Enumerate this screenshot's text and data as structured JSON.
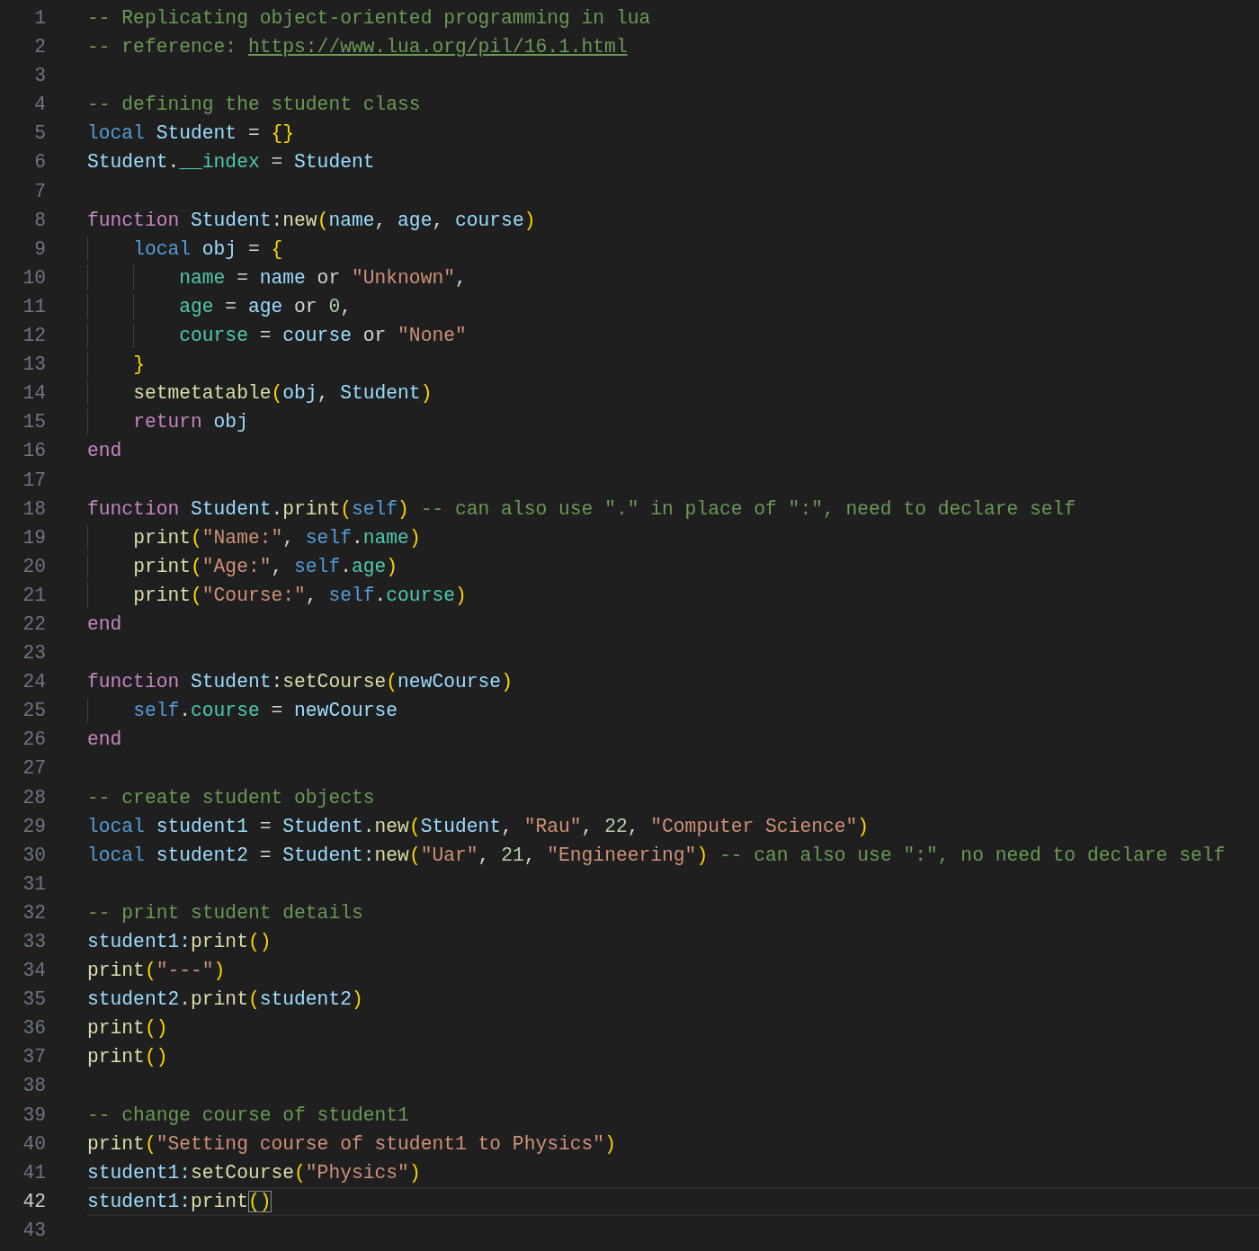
{
  "editor": {
    "lines": [
      {
        "number": "1",
        "selected": false,
        "tokens": [
          {
            "kind": "c",
            "t": "-- Replicating object-oriented programming in lua"
          }
        ]
      },
      {
        "number": "2",
        "selected": false,
        "tokens": [
          {
            "kind": "c",
            "t": "-- reference: "
          },
          {
            "kind": "link",
            "t": "https://www.lua.org/pil/16.1.html"
          }
        ]
      },
      {
        "number": "3",
        "selected": false
      },
      {
        "number": "4",
        "selected": false,
        "tokens": [
          {
            "kind": "c",
            "t": "-- defining the student class"
          }
        ]
      },
      {
        "number": "5",
        "selected": false,
        "tokens": [
          {
            "kind": "st",
            "t": "local "
          },
          {
            "kind": "v",
            "t": "Student"
          },
          {
            "kind": "p",
            "t": " = "
          },
          {
            "kind": "b",
            "t": "{}"
          }
        ]
      },
      {
        "number": "6",
        "selected": false,
        "tokens": [
          {
            "kind": "v",
            "t": "Student"
          },
          {
            "kind": "p",
            "t": "."
          },
          {
            "kind": "pr",
            "t": "__index"
          },
          {
            "kind": "p",
            "t": " = "
          },
          {
            "kind": "v",
            "t": "Student"
          }
        ]
      },
      {
        "number": "7",
        "selected": false
      },
      {
        "number": "8",
        "selected": false,
        "tokens": [
          {
            "kind": "kw",
            "t": "function "
          },
          {
            "kind": "v",
            "t": "Student"
          },
          {
            "kind": "p",
            "t": ":"
          },
          {
            "kind": "fn",
            "t": "new"
          },
          {
            "kind": "b",
            "t": "("
          },
          {
            "kind": "v",
            "t": "name"
          },
          {
            "kind": "p",
            "t": ", "
          },
          {
            "kind": "v",
            "t": "age"
          },
          {
            "kind": "p",
            "t": ", "
          },
          {
            "kind": "v",
            "t": "course"
          },
          {
            "kind": "b",
            "t": ")"
          }
        ]
      },
      {
        "number": "9",
        "selected": false,
        "tokens": [
          {
            "kind": "st",
            "t": "    local "
          },
          {
            "kind": "v",
            "t": "obj"
          },
          {
            "kind": "p",
            "t": " = "
          },
          {
            "kind": "b",
            "t": "{"
          }
        ]
      },
      {
        "number": "10",
        "selected": false,
        "tokens": [
          {
            "kind": "pr",
            "t": "        name"
          },
          {
            "kind": "p",
            "t": " = "
          },
          {
            "kind": "v",
            "t": "name"
          },
          {
            "kind": "p",
            "t": " or "
          },
          {
            "kind": "s",
            "t": "\"Unknown\""
          },
          {
            "kind": "p",
            "t": ","
          }
        ]
      },
      {
        "number": "11",
        "selected": false,
        "tokens": [
          {
            "kind": "pr",
            "t": "        age"
          },
          {
            "kind": "p",
            "t": " = "
          },
          {
            "kind": "v",
            "t": "age"
          },
          {
            "kind": "p",
            "t": " or "
          },
          {
            "kind": "n",
            "t": "0"
          },
          {
            "kind": "p",
            "t": ","
          }
        ]
      },
      {
        "number": "12",
        "selected": false,
        "tokens": [
          {
            "kind": "pr",
            "t": "        course"
          },
          {
            "kind": "p",
            "t": " = "
          },
          {
            "kind": "v",
            "t": "course"
          },
          {
            "kind": "p",
            "t": " or "
          },
          {
            "kind": "s",
            "t": "\"None\""
          }
        ]
      },
      {
        "number": "13",
        "selected": false,
        "tokens": [
          {
            "kind": "b",
            "t": "    }"
          }
        ]
      },
      {
        "number": "14",
        "selected": false,
        "tokens": [
          {
            "kind": "fn",
            "t": "    setmetatable"
          },
          {
            "kind": "b",
            "t": "("
          },
          {
            "kind": "v",
            "t": "obj"
          },
          {
            "kind": "p",
            "t": ", "
          },
          {
            "kind": "v",
            "t": "Student"
          },
          {
            "kind": "b",
            "t": ")"
          }
        ]
      },
      {
        "number": "15",
        "selected": false,
        "tokens": [
          {
            "kind": "kw",
            "t": "    return "
          },
          {
            "kind": "v",
            "t": "obj"
          }
        ]
      },
      {
        "number": "16",
        "selected": false,
        "tokens": [
          {
            "kind": "kw",
            "t": "end"
          }
        ]
      },
      {
        "number": "17",
        "selected": false
      },
      {
        "number": "18",
        "selected": false,
        "tokens": [
          {
            "kind": "kw",
            "t": "function "
          },
          {
            "kind": "v",
            "t": "Student"
          },
          {
            "kind": "p",
            "t": "."
          },
          {
            "kind": "fn",
            "t": "print"
          },
          {
            "kind": "b",
            "t": "("
          },
          {
            "kind": "st",
            "t": "self"
          },
          {
            "kind": "b",
            "t": ")"
          },
          {
            "kind": "c",
            "t": " -- can also use \".\" in place of \":\", need to declare self"
          }
        ]
      },
      {
        "number": "19",
        "selected": false,
        "tokens": [
          {
            "kind": "fn",
            "t": "    print"
          },
          {
            "kind": "b",
            "t": "("
          },
          {
            "kind": "s",
            "t": "\"Name:\""
          },
          {
            "kind": "p",
            "t": ", "
          },
          {
            "kind": "st",
            "t": "self"
          },
          {
            "kind": "p",
            "t": "."
          },
          {
            "kind": "pr",
            "t": "name"
          },
          {
            "kind": "b",
            "t": ")"
          }
        ]
      },
      {
        "number": "20",
        "selected": false,
        "tokens": [
          {
            "kind": "fn",
            "t": "    print"
          },
          {
            "kind": "b",
            "t": "("
          },
          {
            "kind": "s",
            "t": "\"Age:\""
          },
          {
            "kind": "p",
            "t": ", "
          },
          {
            "kind": "st",
            "t": "self"
          },
          {
            "kind": "p",
            "t": "."
          },
          {
            "kind": "pr",
            "t": "age"
          },
          {
            "kind": "b",
            "t": ")"
          }
        ]
      },
      {
        "number": "21",
        "selected": false,
        "tokens": [
          {
            "kind": "fn",
            "t": "    print"
          },
          {
            "kind": "b",
            "t": "("
          },
          {
            "kind": "s",
            "t": "\"Course:\""
          },
          {
            "kind": "p",
            "t": ", "
          },
          {
            "kind": "st",
            "t": "self"
          },
          {
            "kind": "p",
            "t": "."
          },
          {
            "kind": "pr",
            "t": "course"
          },
          {
            "kind": "b",
            "t": ")"
          }
        ]
      },
      {
        "number": "22",
        "selected": false,
        "tokens": [
          {
            "kind": "kw",
            "t": "end"
          }
        ]
      },
      {
        "number": "23",
        "selected": false
      },
      {
        "number": "24",
        "selected": false,
        "tokens": [
          {
            "kind": "kw",
            "t": "function "
          },
          {
            "kind": "v",
            "t": "Student"
          },
          {
            "kind": "p",
            "t": ":"
          },
          {
            "kind": "fn",
            "t": "setCourse"
          },
          {
            "kind": "b",
            "t": "("
          },
          {
            "kind": "v",
            "t": "newCourse"
          },
          {
            "kind": "b",
            "t": ")"
          }
        ]
      },
      {
        "number": "25",
        "selected": false,
        "tokens": [
          {
            "kind": "st",
            "t": "    self"
          },
          {
            "kind": "p",
            "t": "."
          },
          {
            "kind": "pr",
            "t": "course"
          },
          {
            "kind": "p",
            "t": " = "
          },
          {
            "kind": "v",
            "t": "newCourse"
          }
        ]
      },
      {
        "number": "26",
        "selected": false,
        "tokens": [
          {
            "kind": "kw",
            "t": "end"
          }
        ]
      },
      {
        "number": "27",
        "selected": false
      },
      {
        "number": "28",
        "selected": false,
        "tokens": [
          {
            "kind": "c",
            "t": "-- create student objects"
          }
        ]
      },
      {
        "number": "29",
        "selected": false,
        "tokens": [
          {
            "kind": "st",
            "t": "local "
          },
          {
            "kind": "v",
            "t": "student1"
          },
          {
            "kind": "p",
            "t": " = "
          },
          {
            "kind": "v",
            "t": "Student"
          },
          {
            "kind": "p",
            "t": "."
          },
          {
            "kind": "fn",
            "t": "new"
          },
          {
            "kind": "b",
            "t": "("
          },
          {
            "kind": "v",
            "t": "Student"
          },
          {
            "kind": "p",
            "t": ", "
          },
          {
            "kind": "s",
            "t": "\"Rau\""
          },
          {
            "kind": "p",
            "t": ", "
          },
          {
            "kind": "n",
            "t": "22"
          },
          {
            "kind": "p",
            "t": ", "
          },
          {
            "kind": "s",
            "t": "\"Computer Science\""
          },
          {
            "kind": "b",
            "t": ")"
          }
        ]
      },
      {
        "number": "30",
        "selected": false,
        "tokens": [
          {
            "kind": "st",
            "t": "local "
          },
          {
            "kind": "v",
            "t": "student2"
          },
          {
            "kind": "p",
            "t": " = "
          },
          {
            "kind": "v",
            "t": "Student:"
          },
          {
            "kind": "fn",
            "t": "new"
          },
          {
            "kind": "b",
            "t": "("
          },
          {
            "kind": "s",
            "t": "\"Uar\""
          },
          {
            "kind": "p",
            "t": ", "
          },
          {
            "kind": "n",
            "t": "21"
          },
          {
            "kind": "p",
            "t": ", "
          },
          {
            "kind": "s",
            "t": "\"Engineering\""
          },
          {
            "kind": "b",
            "t": ")"
          },
          {
            "kind": "c",
            "t": " -- can also use \":\", no need to declare self"
          }
        ]
      },
      {
        "number": "31",
        "selected": false
      },
      {
        "number": "32",
        "selected": false,
        "tokens": [
          {
            "kind": "c",
            "t": "-- print student details"
          }
        ]
      },
      {
        "number": "33",
        "selected": false,
        "tokens": [
          {
            "kind": "v",
            "t": "student1:"
          },
          {
            "kind": "fn",
            "t": "print"
          },
          {
            "kind": "b",
            "t": "()"
          }
        ]
      },
      {
        "number": "34",
        "selected": false,
        "tokens": [
          {
            "kind": "fn",
            "t": "print"
          },
          {
            "kind": "b",
            "t": "("
          },
          {
            "kind": "s",
            "t": "\"---\""
          },
          {
            "kind": "b",
            "t": ")"
          }
        ]
      },
      {
        "number": "35",
        "selected": false,
        "tokens": [
          {
            "kind": "v",
            "t": "student2"
          },
          {
            "kind": "p",
            "t": "."
          },
          {
            "kind": "fn",
            "t": "print"
          },
          {
            "kind": "b",
            "t": "("
          },
          {
            "kind": "v",
            "t": "student2"
          },
          {
            "kind": "b",
            "t": ")"
          }
        ]
      },
      {
        "number": "36",
        "selected": false,
        "tokens": [
          {
            "kind": "fn",
            "t": "print"
          },
          {
            "kind": "b",
            "t": "()"
          }
        ]
      },
      {
        "number": "37",
        "selected": false,
        "tokens": [
          {
            "kind": "fn",
            "t": "print"
          },
          {
            "kind": "b",
            "t": "()"
          }
        ]
      },
      {
        "number": "38",
        "selected": false
      },
      {
        "number": "39",
        "selected": false,
        "tokens": [
          {
            "kind": "c",
            "t": "-- change course of student1"
          }
        ]
      },
      {
        "number": "40",
        "selected": false,
        "tokens": [
          {
            "kind": "fn",
            "t": "print"
          },
          {
            "kind": "b",
            "t": "("
          },
          {
            "kind": "s",
            "t": "\"Setting course of student1 to Physics\""
          },
          {
            "kind": "b",
            "t": ")"
          }
        ]
      },
      {
        "number": "41",
        "selected": false,
        "tokens": [
          {
            "kind": "v",
            "t": "student1:"
          },
          {
            "kind": "fn",
            "t": "setCourse"
          },
          {
            "kind": "b",
            "t": "("
          },
          {
            "kind": "s",
            "t": "\"Physics\""
          },
          {
            "kind": "b",
            "t": ")"
          }
        ]
      },
      {
        "number": "42",
        "selected": true,
        "tokens": [
          {
            "kind": "v",
            "t": "student1:"
          },
          {
            "kind": "fn",
            "t": "print"
          },
          {
            "kind": "match",
            "t": "()"
          }
        ]
      },
      {
        "number": "43",
        "selected": false
      }
    ]
  }
}
